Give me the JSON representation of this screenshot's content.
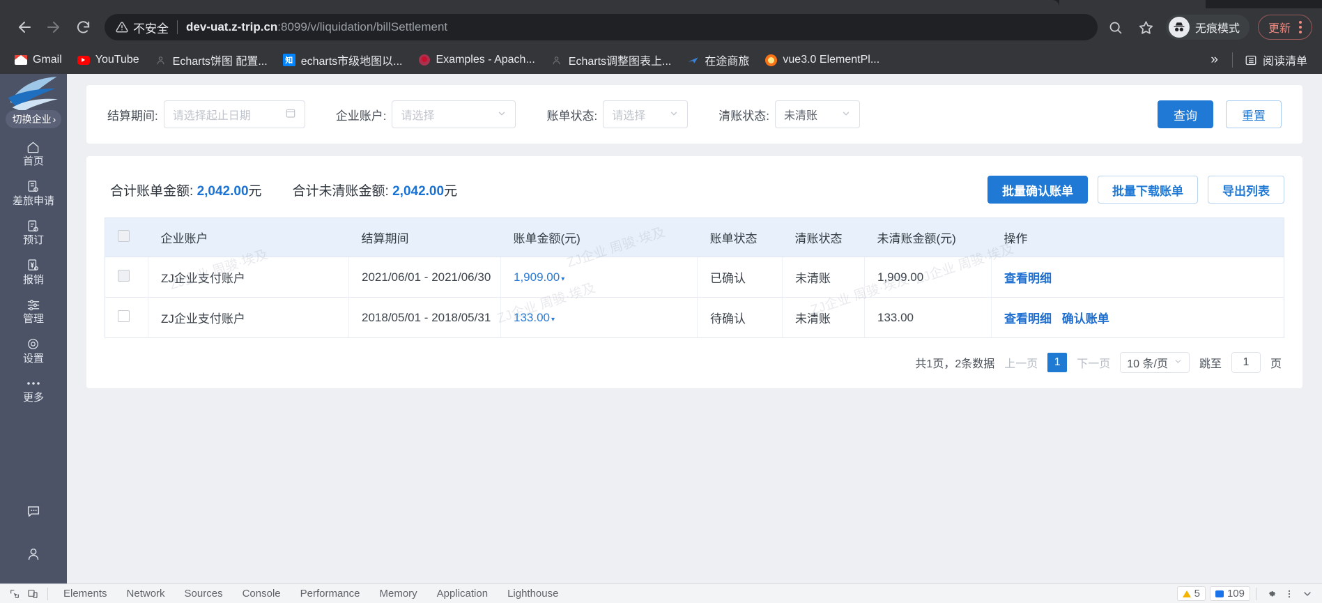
{
  "browser": {
    "security_label": "不安全",
    "url_host": "dev-uat.z-trip.cn",
    "url_rest": ":8099/v/liquidation/billSettlement",
    "incognito_label": "无痕模式",
    "update_label": "更新",
    "reading_list_label": "阅读清单",
    "overflow_label": "»",
    "bookmarks": [
      {
        "label": "Gmail",
        "icon": "gmail-icon"
      },
      {
        "label": "YouTube",
        "icon": "youtube-icon"
      },
      {
        "label": "Echarts饼图 配置...",
        "icon": "blank-page-icon"
      },
      {
        "label": "echarts市级地图以...",
        "icon": "zhihu-icon"
      },
      {
        "label": "Examples - Apach...",
        "icon": "echarts-icon"
      },
      {
        "label": "Echarts调整图表上...",
        "icon": "blank-page-icon"
      },
      {
        "label": "在途商旅",
        "icon": "plane-icon"
      },
      {
        "label": "vue3.0 ElementPl...",
        "icon": "vue-icon"
      }
    ]
  },
  "sidebar": {
    "switch_company": "切换企业",
    "items": [
      {
        "label": "首页",
        "icon": "home-icon"
      },
      {
        "label": "差旅申请",
        "icon": "document-apply-icon"
      },
      {
        "label": "预订",
        "icon": "booking-icon"
      },
      {
        "label": "报销",
        "icon": "reimburse-icon"
      },
      {
        "label": "管理",
        "icon": "sliders-icon"
      },
      {
        "label": "设置",
        "icon": "gear-circle-icon"
      },
      {
        "label": "更多",
        "icon": "ellipsis-icon"
      }
    ],
    "bottom": [
      {
        "icon": "chat-icon"
      },
      {
        "icon": "user-icon"
      }
    ]
  },
  "filters": {
    "period_label": "结算期间:",
    "period_placeholder": "请选择起止日期",
    "period_value": "",
    "account_label": "企业账户:",
    "account_placeholder": "请选择",
    "account_value": "",
    "bill_status_label": "账单状态:",
    "bill_status_placeholder": "请选择",
    "bill_status_value": "",
    "clear_status_label": "清账状态:",
    "clear_status_value": "未清账",
    "search_button": "查询",
    "reset_button": "重置"
  },
  "summary": {
    "total_bill_label": "合计账单金额:",
    "total_bill_amount": "2,042.00",
    "total_bill_unit": "元",
    "total_unsettled_label": "合计未清账金额:",
    "total_unsettled_amount": "2,042.00",
    "total_unsettled_unit": "元"
  },
  "actions": {
    "batch_confirm": "批量确认账单",
    "batch_download": "批量下载账单",
    "export_list": "导出列表"
  },
  "table": {
    "columns": [
      "",
      "企业账户",
      "结算期间",
      "账单金额(元)",
      "账单状态",
      "清账状态",
      "未清账金额(元)",
      "操作"
    ],
    "rows": [
      {
        "account": "ZJ企业支付账户",
        "period": "2021/06/01 - 2021/06/30",
        "bill_amount": "1,909.00",
        "bill_status": "已确认",
        "clear_status": "未清账",
        "unsettled_amount": "1,909.00",
        "actions": [
          "查看明细"
        ]
      },
      {
        "account": "ZJ企业支付账户",
        "period": "2018/05/01 - 2018/05/31",
        "bill_amount": "133.00",
        "bill_status": "待确认",
        "clear_status": "未清账",
        "unsettled_amount": "133.00",
        "actions": [
          "查看明细",
          "确认账单"
        ]
      }
    ],
    "watermark": "ZJ企业 周骏·埃及"
  },
  "pagination": {
    "total_text": "共1页，2条数据",
    "prev": "上一页",
    "current_page": "1",
    "next": "下一页",
    "page_size": "10 条/页",
    "jump_label": "跳至",
    "jump_value": "1",
    "page_unit": "页"
  },
  "devtools": {
    "tabs": [
      "Elements",
      "Network",
      "Sources",
      "Console",
      "Performance",
      "Memory",
      "Application",
      "Lighthouse"
    ],
    "warnings": "5",
    "messages": "109"
  },
  "colors": {
    "accent": "#1f7ad4",
    "sidebar": "#4c5366",
    "chrome": "#35363a",
    "table_header": "#e8f1fb"
  }
}
